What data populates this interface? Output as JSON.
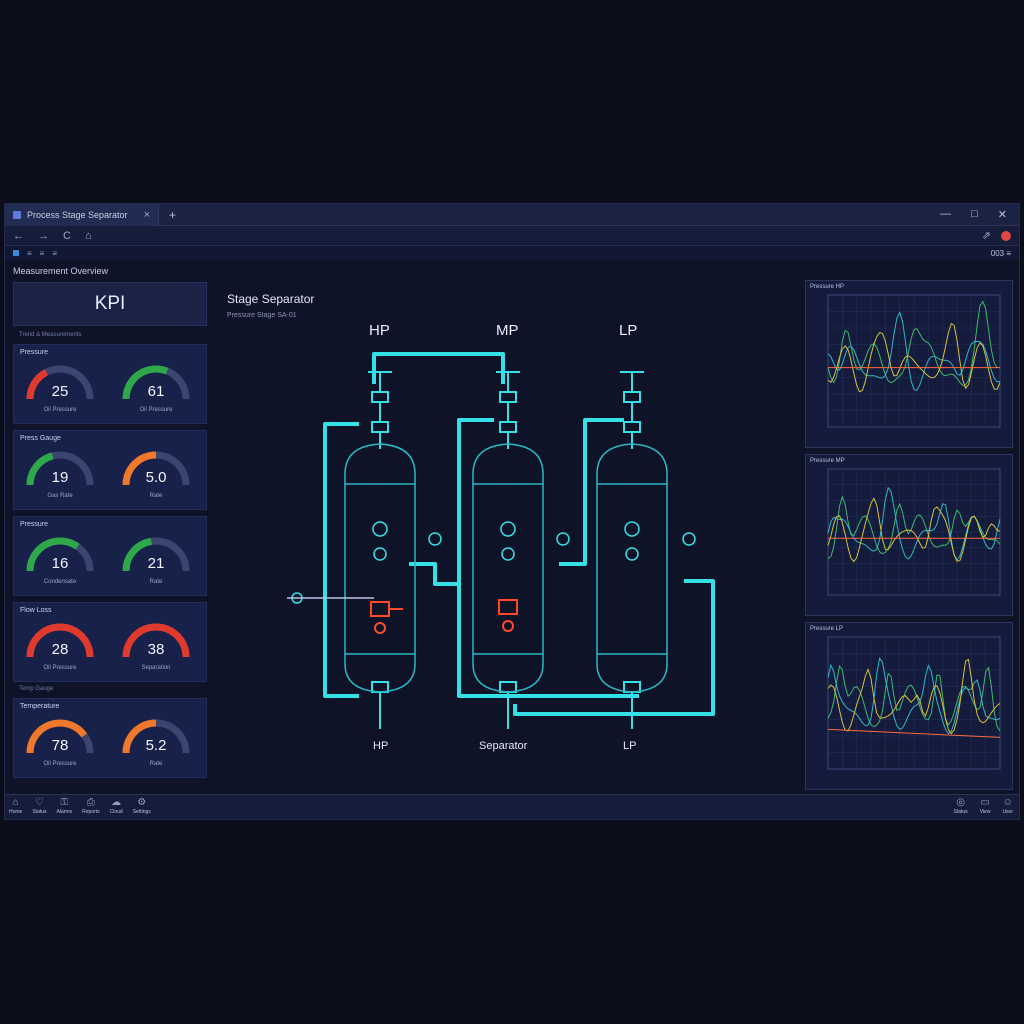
{
  "browser": {
    "tab_title": "Process Stage Separator",
    "tab_close": "×",
    "new_tab": "+",
    "window_controls": {
      "minimize": "—",
      "maximize": "□",
      "close": "✕"
    },
    "nav": {
      "back": "←",
      "forward": "→",
      "reload": "C",
      "home": "⌂",
      "share": "⇗"
    },
    "bookmarks": [
      "≡",
      "≡",
      "≡"
    ],
    "bookmarks_right": "003 ≡"
  },
  "app": {
    "title": "Measurement Overview",
    "kpi": {
      "heading": "KPI",
      "subheading": "Trend & Measurements",
      "groups": [
        {
          "label": "Pressure",
          "gauges": [
            {
              "value": "25",
              "caption": "Oil Pressure",
              "fraction": 0.35,
              "color": "#e03a2f"
            },
            {
              "value": "61",
              "caption": "Oil Pressure",
              "fraction": 0.62,
              "color": "#2fa84a"
            }
          ]
        },
        {
          "label": "Press Gauge",
          "gauges": [
            {
              "value": "19",
              "caption": "Gas Rate",
              "fraction": 0.42,
              "color": "#2fa84a"
            },
            {
              "value": "5.0",
              "caption": "Rate",
              "fraction": 0.5,
              "color": "#f0782a"
            }
          ]
        },
        {
          "label": "Pressure",
          "gauges": [
            {
              "value": "16",
              "caption": "Condensate",
              "fraction": 0.7,
              "color": "#2fa84a"
            },
            {
              "value": "21",
              "caption": "Rate",
              "fraction": 0.45,
              "color": "#2fa84a"
            }
          ]
        },
        {
          "label": "Flow Loss",
          "gauges": [
            {
              "value": "28",
              "caption": "Oil Pressure",
              "fraction": 1.0,
              "color": "#e03a2f"
            },
            {
              "value": "38",
              "caption": "Separation",
              "fraction": 1.0,
              "color": "#e03a2f"
            }
          ]
        },
        {
          "label": "Temperature",
          "note": "Temp Gauge",
          "gauges": [
            {
              "value": "78",
              "caption": "Oil Pressure",
              "fraction": 0.8,
              "color": "#f0782a"
            },
            {
              "value": "5.2",
              "caption": "Rate",
              "fraction": 0.5,
              "color": "#f0782a"
            }
          ]
        }
      ]
    },
    "diagram": {
      "title": "Stage Separator",
      "subtitle": "Pressure Stage SA-01",
      "top_labels": [
        "HP",
        "MP",
        "LP"
      ],
      "bottom_labels": [
        "HP",
        "Separator",
        "LP"
      ]
    },
    "trends": [
      {
        "title": "Pressure HP"
      },
      {
        "title": "Pressure MP"
      },
      {
        "title": "Pressure LP"
      }
    ]
  },
  "statusbar": {
    "left_items": [
      {
        "icon": "⌂",
        "label": "Home"
      },
      {
        "icon": "♡",
        "label": "Status"
      },
      {
        "icon": "⚿",
        "label": "Alarms"
      },
      {
        "icon": "⎙",
        "label": "Reports"
      },
      {
        "icon": "☁",
        "label": "Cloud"
      },
      {
        "icon": "⚙",
        "label": "Settings"
      }
    ],
    "right_items": [
      {
        "icon": "◎",
        "label": "Status"
      },
      {
        "icon": "▭",
        "label": "View"
      },
      {
        "icon": "☺",
        "label": "User"
      }
    ]
  },
  "colors": {
    "pipe": "#35e0e6",
    "pipe_dim": "#1f8b9a",
    "alarm": "#ff4b2b",
    "trend_green": "#3fb86a",
    "trend_cyan": "#2fb8c8",
    "trend_orange": "#ff6a3a",
    "trend_yellow": "#d8c23a"
  }
}
